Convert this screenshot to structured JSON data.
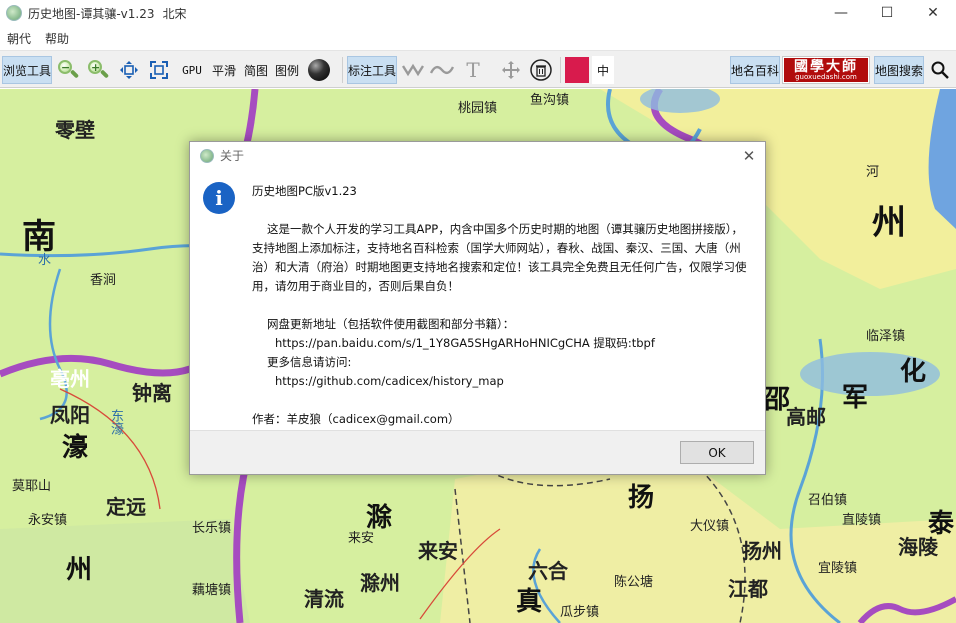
{
  "window": {
    "title": "历史地图-谭其骧-v1.23",
    "dynasty": "北宋",
    "min_glyph": "—",
    "max_glyph": "☐",
    "close_glyph": "✕"
  },
  "menu": {
    "items": [
      "朝代",
      "帮助"
    ]
  },
  "toolbar": {
    "browse": "浏览工具",
    "gpu": "GPU",
    "smooth": "平滑",
    "simple_map": "简图",
    "legend": "图例",
    "annotate": "标注工具",
    "font_size": "中",
    "place_wiki": "地名百科",
    "logo_text": "國學大師",
    "logo_url": "guoxuedashi.com",
    "map_search": "地图搜索",
    "accent_color": "#d81b4d"
  },
  "dialog": {
    "title": "关于",
    "close_glyph": "✕",
    "heading": "历史地图PC版v1.23",
    "description": "这是一款个人开发的学习工具APP，内含中国多个历史时期的地图（谭其骧历史地图拼接版），支持地图上添加标注，支持地名百科检索（国学大师网站），春秋、战国、秦汉、三国、大唐（州治）和大清（府治）时期地图更支持地名搜索和定位！该工具完全免费且无任何广告，仅限学习使用，请勿用于商业目的，否则后果自负！",
    "update_label": "网盘更新地址（包括软件使用截图和部分书籍）：",
    "update_url": "https://pan.baidu.com/s/1_1Y8GA5SHgARHoHNICgCHA 提取码:tbpf",
    "more_info_label": "更多信息请访问:",
    "github_url": "https://github.com/cadicex/history_map",
    "author": "作者：羊皮狼（cadicex@gmail.com）",
    "ok_label": "OK"
  },
  "map": {
    "labels": [
      "零壁",
      "南",
      "香涧",
      "亳州",
      "钟离",
      "凤阳",
      "濠",
      "东濠",
      "水",
      "莫耶山",
      "定远",
      "永安镇",
      "州",
      "长乐镇",
      "藕塘镇",
      "清流",
      "滁",
      "来安",
      "滁州",
      "来安",
      "六合",
      "真",
      "扬",
      "扬州",
      "江都",
      "海陵",
      "泰",
      "大仪镇",
      "高邮",
      "军",
      "州",
      "河",
      "鱼沟镇",
      "桃园镇",
      "临泽镇",
      "直陵镇",
      "召伯镇",
      "宜陵镇",
      "陈公塘",
      "瓜步镇",
      "邵",
      "化"
    ]
  }
}
